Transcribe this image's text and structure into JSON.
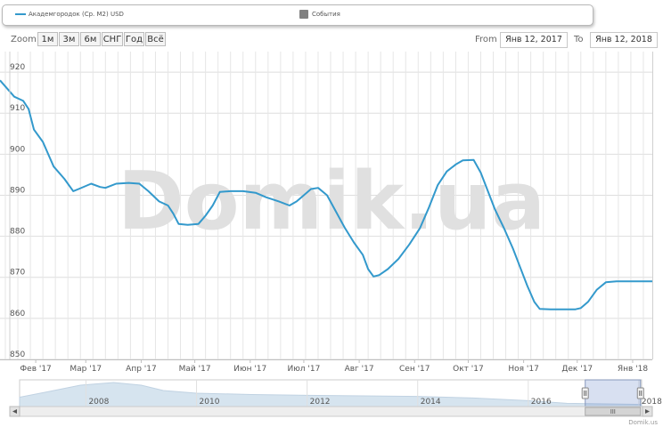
{
  "legend": {
    "series_label": "Академгородок (Ср. М2) USD",
    "events_label": "События",
    "series_color": "#3399cc",
    "events_color": "#808080"
  },
  "toolbar": {
    "zoom_label": "Zoom",
    "buttons": [
      "1м",
      "3м",
      "6м",
      "СНГ",
      "Год",
      "Всё"
    ],
    "from_label": "From",
    "from_value": "Янв 12, 2017",
    "to_label": "To",
    "to_value": "Янв 12, 2018"
  },
  "watermark": "Domik.ua",
  "credits": "Domik.us",
  "navigator": {
    "year_labels": [
      "2008",
      "2010",
      "2012",
      "2014",
      "2016",
      "2018"
    ]
  },
  "chart_data": {
    "type": "line",
    "xlabel": "",
    "ylabel": "",
    "ylim": [
      850,
      925
    ],
    "xlim": [
      "2017-01-12",
      "2018-01-12"
    ],
    "yticks": [
      850,
      860,
      870,
      880,
      890,
      900,
      910,
      920
    ],
    "xtick_labels": [
      {
        "date": "2017-02-01",
        "label": "Фев '17"
      },
      {
        "date": "2017-03-01",
        "label": "Мар '17"
      },
      {
        "date": "2017-04-01",
        "label": "Апр '17"
      },
      {
        "date": "2017-05-01",
        "label": "Май '17"
      },
      {
        "date": "2017-06-01",
        "label": "Июн '17"
      },
      {
        "date": "2017-07-01",
        "label": "Июл '17"
      },
      {
        "date": "2017-08-01",
        "label": "Авг '17"
      },
      {
        "date": "2017-09-01",
        "label": "Сен '17"
      },
      {
        "date": "2017-10-01",
        "label": "Окт '17"
      },
      {
        "date": "2017-11-01",
        "label": "Ноя '17"
      },
      {
        "date": "2017-12-01",
        "label": "Дек '17"
      },
      {
        "date": "2018-01-01",
        "label": "Янв '18"
      }
    ],
    "grid": true,
    "series": [
      {
        "color": "#3399cc",
        "points": [
          [
            "2017-01-12",
            918
          ],
          [
            "2017-01-20",
            914
          ],
          [
            "2017-01-25",
            913
          ],
          [
            "2017-01-28",
            911
          ],
          [
            "2017-01-31",
            906
          ],
          [
            "2017-02-05",
            903
          ],
          [
            "2017-02-11",
            897
          ],
          [
            "2017-02-17",
            894
          ],
          [
            "2017-02-22",
            891
          ],
          [
            "2017-02-25",
            891.5
          ],
          [
            "2017-03-04",
            892.8
          ],
          [
            "2017-03-09",
            892
          ],
          [
            "2017-03-12",
            891.8
          ],
          [
            "2017-03-18",
            892.8
          ],
          [
            "2017-03-25",
            893
          ],
          [
            "2017-03-31",
            892.8
          ],
          [
            "2017-04-05",
            891
          ],
          [
            "2017-04-11",
            888.5
          ],
          [
            "2017-04-16",
            887.5
          ],
          [
            "2017-04-19",
            885.5
          ],
          [
            "2017-04-22",
            883
          ],
          [
            "2017-04-27",
            882.8
          ],
          [
            "2017-05-03",
            883
          ],
          [
            "2017-05-07",
            885
          ],
          [
            "2017-05-11",
            887.5
          ],
          [
            "2017-05-15",
            890.8
          ],
          [
            "2017-05-21",
            891
          ],
          [
            "2017-05-28",
            891
          ],
          [
            "2017-06-04",
            890.6
          ],
          [
            "2017-06-10",
            889.5
          ],
          [
            "2017-06-17",
            888.5
          ],
          [
            "2017-06-23",
            887.5
          ],
          [
            "2017-06-27",
            888.5
          ],
          [
            "2017-07-01",
            890
          ],
          [
            "2017-07-05",
            891.5
          ],
          [
            "2017-07-09",
            891.8
          ],
          [
            "2017-07-14",
            890
          ],
          [
            "2017-07-19",
            886
          ],
          [
            "2017-07-24",
            882
          ],
          [
            "2017-07-29",
            878.5
          ],
          [
            "2017-08-03",
            875.5
          ],
          [
            "2017-08-06",
            872
          ],
          [
            "2017-08-09",
            870.2
          ],
          [
            "2017-08-12",
            870.5
          ],
          [
            "2017-08-17",
            872
          ],
          [
            "2017-08-23",
            874.5
          ],
          [
            "2017-08-29",
            878
          ],
          [
            "2017-09-04",
            882
          ],
          [
            "2017-09-09",
            887
          ],
          [
            "2017-09-14",
            892.5
          ],
          [
            "2017-09-19",
            895.8
          ],
          [
            "2017-09-24",
            897.5
          ],
          [
            "2017-09-28",
            898.5
          ],
          [
            "2017-10-04",
            898.6
          ],
          [
            "2017-10-08",
            895.5
          ],
          [
            "2017-10-12",
            891
          ],
          [
            "2017-10-16",
            886.5
          ],
          [
            "2017-10-21",
            882
          ],
          [
            "2017-10-26",
            877
          ],
          [
            "2017-10-30",
            872.5
          ],
          [
            "2017-11-03",
            868
          ],
          [
            "2017-11-07",
            864
          ],
          [
            "2017-11-10",
            862.3
          ],
          [
            "2017-11-16",
            862.2
          ],
          [
            "2017-11-23",
            862.2
          ],
          [
            "2017-11-30",
            862.2
          ],
          [
            "2017-12-03",
            862.5
          ],
          [
            "2017-12-07",
            864
          ],
          [
            "2017-12-12",
            867
          ],
          [
            "2017-12-17",
            868.8
          ],
          [
            "2017-12-23",
            869
          ],
          [
            "2017-12-31",
            869
          ],
          [
            "2018-01-12",
            869
          ]
        ]
      }
    ],
    "navigator_series": [
      [
        2006.8,
        0.35
      ],
      [
        2007.3,
        0.55
      ],
      [
        2007.9,
        0.8
      ],
      [
        2008.5,
        0.9
      ],
      [
        2009.0,
        0.8
      ],
      [
        2009.4,
        0.6
      ],
      [
        2010.0,
        0.5
      ],
      [
        2011.0,
        0.45
      ],
      [
        2012.0,
        0.42
      ],
      [
        2013.0,
        0.4
      ],
      [
        2014.0,
        0.38
      ],
      [
        2015.0,
        0.32
      ],
      [
        2016.0,
        0.22
      ],
      [
        2016.7,
        0.12
      ],
      [
        2018.05,
        0.08
      ]
    ],
    "navigator_range": {
      "from": 2017.03,
      "to": 2018.03
    }
  }
}
